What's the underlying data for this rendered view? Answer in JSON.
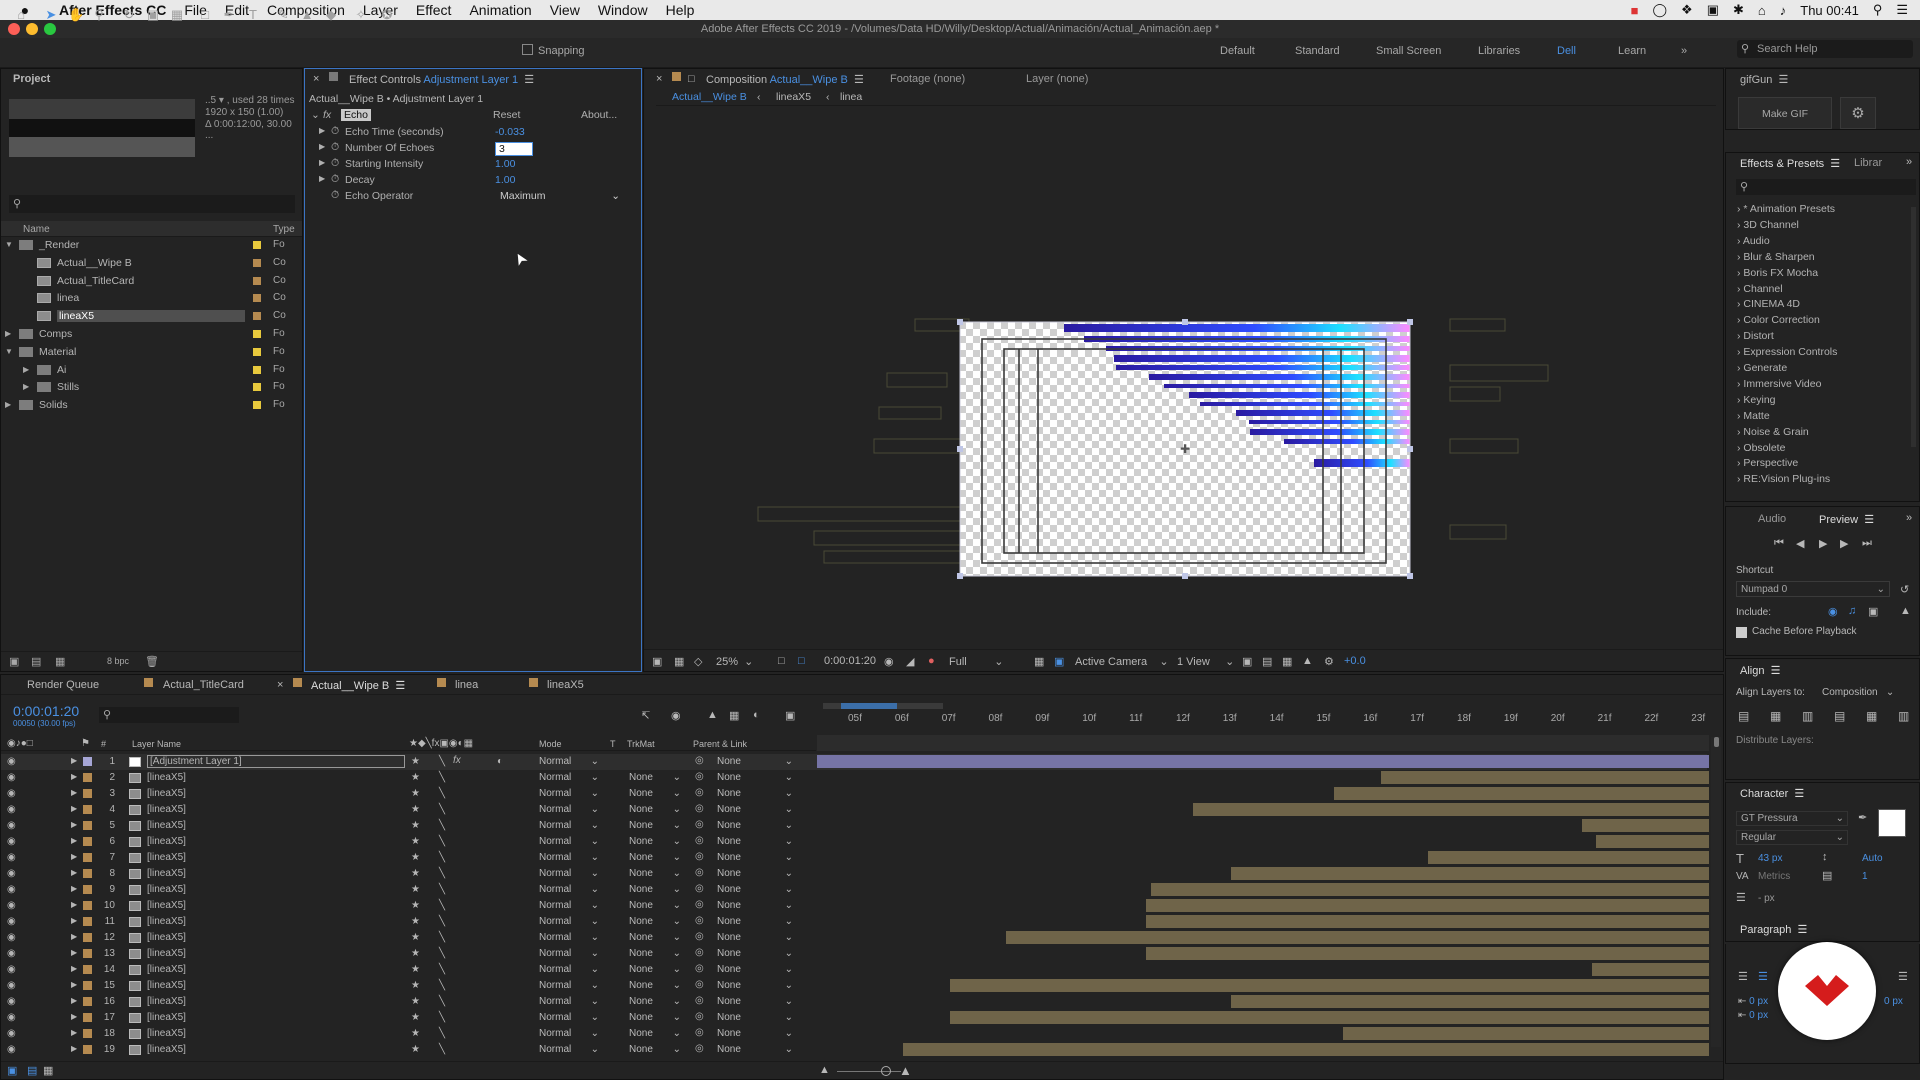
{
  "menubar": {
    "app": "After Effects CC",
    "items": [
      "File",
      "Edit",
      "Composition",
      "Layer",
      "Effect",
      "Animation",
      "View",
      "Window",
      "Help"
    ],
    "clock": "Thu 00:41"
  },
  "title": "Adobe After Effects CC 2019 - /Volumes/Data HD/Willy/Desktop/Actual/Animación/Actual_Animación.aep *",
  "toolbar": {
    "snapping": "Snapping",
    "workspaces": [
      "Default",
      "Standard",
      "Small Screen",
      "Libraries",
      "Dell",
      "Learn"
    ],
    "active_workspace": "Dell",
    "search": "Search Help"
  },
  "project": {
    "tab": "Project",
    "info1": "..5 ▾ , used 28 times",
    "info2": "1920 x 150 (1.00)",
    "info3": "Δ 0:00:12:00, 30.00 ...",
    "col_name": "Name",
    "col_type": "Type",
    "items": [
      {
        "name": "_Render",
        "type": "Fo",
        "level": 0,
        "kind": "folder",
        "open": true,
        "color": "#e8c93d"
      },
      {
        "name": "Actual__Wipe B",
        "type": "Co",
        "level": 1,
        "kind": "comp",
        "color": "#b58a50"
      },
      {
        "name": "Actual_TitleCard",
        "type": "Co",
        "level": 1,
        "kind": "comp",
        "color": "#b58a50"
      },
      {
        "name": "linea",
        "type": "Co",
        "level": 1,
        "kind": "comp",
        "color": "#b58a50"
      },
      {
        "name": "lineaX5",
        "type": "Co",
        "level": 1,
        "kind": "comp",
        "color": "#b58a50",
        "selected": true
      },
      {
        "name": "Comps",
        "type": "Fo",
        "level": 0,
        "kind": "folder",
        "color": "#e8c93d"
      },
      {
        "name": "Material",
        "type": "Fo",
        "level": 0,
        "kind": "folder",
        "open": true,
        "color": "#e8c93d"
      },
      {
        "name": "Ai",
        "type": "Fo",
        "level": 1,
        "kind": "folder",
        "color": "#e8c93d"
      },
      {
        "name": "Stills",
        "type": "Fo",
        "level": 1,
        "kind": "folder",
        "color": "#e8c93d"
      },
      {
        "name": "Solids",
        "type": "Fo",
        "level": 0,
        "kind": "folder",
        "color": "#e8c93d"
      }
    ],
    "bpc": "8 bpc"
  },
  "effect_controls": {
    "tab": "Effect Controls",
    "layer": "Adjustment Layer 1",
    "subtitle": "Actual__Wipe B • Adjustment Layer 1",
    "effect": "Echo",
    "reset": "Reset",
    "about": "About...",
    "params": [
      {
        "name": "Echo Time (seconds)",
        "value": "-0.033"
      },
      {
        "name": "Number Of Echoes",
        "value": "3",
        "editing": true
      },
      {
        "name": "Starting Intensity",
        "value": "1.00"
      },
      {
        "name": "Decay",
        "value": "1.00"
      },
      {
        "name": "Echo Operator",
        "value": "Maximum",
        "dropdown": true
      }
    ]
  },
  "composition": {
    "tab": "Composition",
    "comp": "Actual__Wipe B",
    "footage": "Footage (none)",
    "layer": "Layer (none)",
    "breadcrumbs": [
      "Actual__Wipe B",
      "lineaX5",
      "linea"
    ],
    "zoom": "25%",
    "time": "0:00:01:20",
    "resolution": "Full",
    "camera": "Active Camera",
    "views": "1 View",
    "exposure": "+0.0"
  },
  "right": {
    "gifgun": "gifGun",
    "make_gif": "Make GIF",
    "effects_tab": "Effects & Presets",
    "libraries_tab": "Librar",
    "presets": [
      "* Animation Presets",
      "3D Channel",
      "Audio",
      "Blur & Sharpen",
      "Boris FX Mocha",
      "Channel",
      "CINEMA 4D",
      "Color Correction",
      "Distort",
      "Expression Controls",
      "Generate",
      "Immersive Video",
      "Keying",
      "Matte",
      "Noise & Grain",
      "Obsolete",
      "Perspective",
      "RE:Vision Plug-ins"
    ],
    "audio": "Audio",
    "preview": "Preview",
    "shortcut_label": "Shortcut",
    "shortcut": "Numpad 0",
    "include": "Include:",
    "cache": "Cache Before Playback",
    "align": "Align",
    "align_to_label": "Align Layers to:",
    "align_to": "Composition",
    "distribute": "Distribute Layers:",
    "character": "Character",
    "font": "GT Pressura",
    "style": "Regular",
    "size": "43 px",
    "leading": "Auto",
    "kerning": "Metrics",
    "tracking": "1",
    "stroke": "- px",
    "paragraph": "Paragraph",
    "indent1": "0 px",
    "indent2": "0 px",
    "indent3": "0 px"
  },
  "timeline": {
    "tabs": [
      "Render Queue",
      "Actual_TitleCard",
      "Actual__Wipe B",
      "linea",
      "lineaX5"
    ],
    "active_tab": "Actual__Wipe B",
    "time": "0:00:01:20",
    "fps": "00050 (30.00 fps)",
    "col_layer": "Layer Name",
    "col_mode": "Mode",
    "col_t": "T",
    "col_trkmat": "TrkMat",
    "col_parent": "Parent & Link",
    "ticks": [
      "05f",
      "06f",
      "07f",
      "08f",
      "09f",
      "10f",
      "11f",
      "12f",
      "13f",
      "14f",
      "15f",
      "16f",
      "17f",
      "18f",
      "19f",
      "20f",
      "21f",
      "22f",
      "23f"
    ],
    "layers": [
      {
        "n": "1",
        "name": "[Adjustment Layer 1]",
        "mode": "Normal",
        "trk": "",
        "parent": "None",
        "start": 0,
        "adj": true
      },
      {
        "n": "2",
        "name": "[lineaX5]",
        "mode": "Normal",
        "trk": "None",
        "parent": "None",
        "start": 16.2
      },
      {
        "n": "3",
        "name": "[lineaX5]",
        "mode": "Normal",
        "trk": "None",
        "parent": "None",
        "start": 15.2
      },
      {
        "n": "4",
        "name": "[lineaX5]",
        "mode": "Normal",
        "trk": "None",
        "parent": "None",
        "start": 12.2
      },
      {
        "n": "5",
        "name": "[lineaX5]",
        "mode": "Normal",
        "trk": "None",
        "parent": "None",
        "start": 20.5
      },
      {
        "n": "6",
        "name": "[lineaX5]",
        "mode": "Normal",
        "trk": "None",
        "parent": "None",
        "start": 20.8
      },
      {
        "n": "7",
        "name": "[lineaX5]",
        "mode": "Normal",
        "trk": "None",
        "parent": "None",
        "start": 17.2
      },
      {
        "n": "8",
        "name": "[lineaX5]",
        "mode": "Normal",
        "trk": "None",
        "parent": "None",
        "start": 13.0
      },
      {
        "n": "9",
        "name": "[lineaX5]",
        "mode": "Normal",
        "trk": "None",
        "parent": "None",
        "start": 11.3
      },
      {
        "n": "10",
        "name": "[lineaX5]",
        "mode": "Normal",
        "trk": "None",
        "parent": "None",
        "start": 11.2
      },
      {
        "n": "11",
        "name": "[lineaX5]",
        "mode": "Normal",
        "trk": "None",
        "parent": "None",
        "start": 11.2
      },
      {
        "n": "12",
        "name": "[lineaX5]",
        "mode": "Normal",
        "trk": "None",
        "parent": "None",
        "start": 8.2
      },
      {
        "n": "13",
        "name": "[lineaX5]",
        "mode": "Normal",
        "trk": "None",
        "parent": "None",
        "start": 11.2
      },
      {
        "n": "14",
        "name": "[lineaX5]",
        "mode": "Normal",
        "trk": "None",
        "parent": "None",
        "start": 20.7
      },
      {
        "n": "15",
        "name": "[lineaX5]",
        "mode": "Normal",
        "trk": "None",
        "parent": "None",
        "start": 7.0
      },
      {
        "n": "16",
        "name": "[lineaX5]",
        "mode": "Normal",
        "trk": "None",
        "parent": "None",
        "start": 13.0
      },
      {
        "n": "17",
        "name": "[lineaX5]",
        "mode": "Normal",
        "trk": "None",
        "parent": "None",
        "start": 7.0
      },
      {
        "n": "18",
        "name": "[lineaX5]",
        "mode": "Normal",
        "trk": "None",
        "parent": "None",
        "start": 15.4
      },
      {
        "n": "19",
        "name": "[lineaX5]",
        "mode": "Normal",
        "trk": "None",
        "parent": "None",
        "start": 6.0
      }
    ]
  }
}
